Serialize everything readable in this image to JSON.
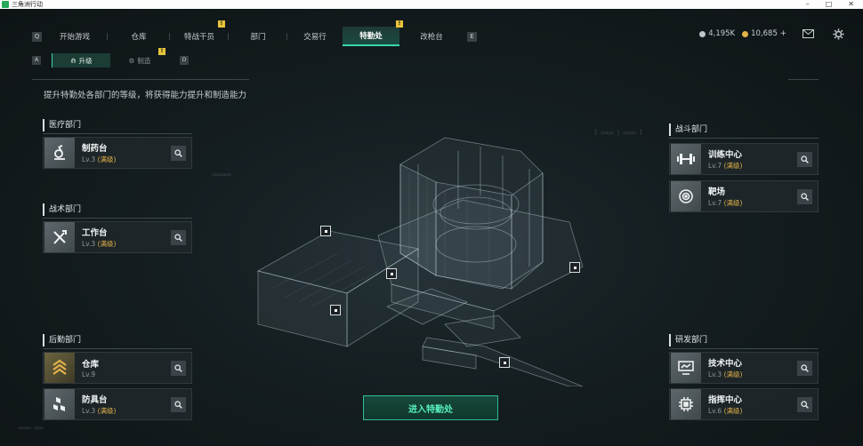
{
  "window": {
    "title": "三角洲行动",
    "controls": [
      "–",
      "□",
      "✕"
    ]
  },
  "nav": {
    "left_key": "Q",
    "right_key": "E",
    "tabs": [
      {
        "label": "开始游戏",
        "active": false,
        "alert": ""
      },
      {
        "label": "仓库",
        "active": false,
        "alert": ""
      },
      {
        "label": "特战干员",
        "active": false,
        "alert": "!"
      },
      {
        "label": "部门",
        "active": false,
        "alert": ""
      },
      {
        "label": "交易行",
        "active": false,
        "alert": ""
      },
      {
        "label": "特勤处",
        "active": true,
        "alert": "!"
      },
      {
        "label": "改枪台",
        "active": false,
        "alert": ""
      }
    ]
  },
  "currency": {
    "silver": "4,195K",
    "gold": "10,685",
    "plus": "+",
    "mail_icon": "mail-icon",
    "settings_icon": "gear-icon"
  },
  "subnav": {
    "left_key": "A",
    "right_key": "D",
    "tabs": [
      {
        "label": "升级",
        "active": true,
        "alert": ""
      },
      {
        "label": "制造",
        "active": false,
        "alert": "!"
      }
    ]
  },
  "description": "提升特勤处各部门的等级，将获得能力提升和制造能力",
  "departments": {
    "medical": {
      "title": "医疗部门",
      "cards": [
        {
          "name": "制药台",
          "level": "Lv.3",
          "max": "(满级)",
          "icon": "microscope-icon"
        }
      ]
    },
    "tactical": {
      "title": "战术部门",
      "cards": [
        {
          "name": "工作台",
          "level": "Lv.3",
          "max": "(满级)",
          "icon": "tools-icon"
        }
      ]
    },
    "logistics": {
      "title": "后勤部门",
      "cards": [
        {
          "name": "仓库",
          "level": "Lv.9",
          "max": "",
          "icon": "rank-chevron-icon"
        },
        {
          "name": "防具台",
          "level": "Lv.3",
          "max": "(满级)",
          "icon": "cubes-icon"
        }
      ]
    },
    "combat": {
      "title": "战斗部门",
      "cards": [
        {
          "name": "训练中心",
          "level": "Lv.7",
          "max": "(满级)",
          "icon": "dumbbell-icon"
        },
        {
          "name": "靶场",
          "level": "Lv.7",
          "max": "(满级)",
          "icon": "target-icon"
        }
      ]
    },
    "research": {
      "title": "研发部门",
      "cards": [
        {
          "name": "技术中心",
          "level": "Lv.3",
          "max": "(满级)",
          "icon": "monitor-icon"
        },
        {
          "name": "指挥中心",
          "level": "Lv.6",
          "max": "(满级)",
          "icon": "chip-icon"
        }
      ]
    }
  },
  "enter_button": "进入特勤处",
  "colors": {
    "accent": "#39d6a8",
    "gold": "#e2b24a",
    "alert": "#e7c43a"
  }
}
